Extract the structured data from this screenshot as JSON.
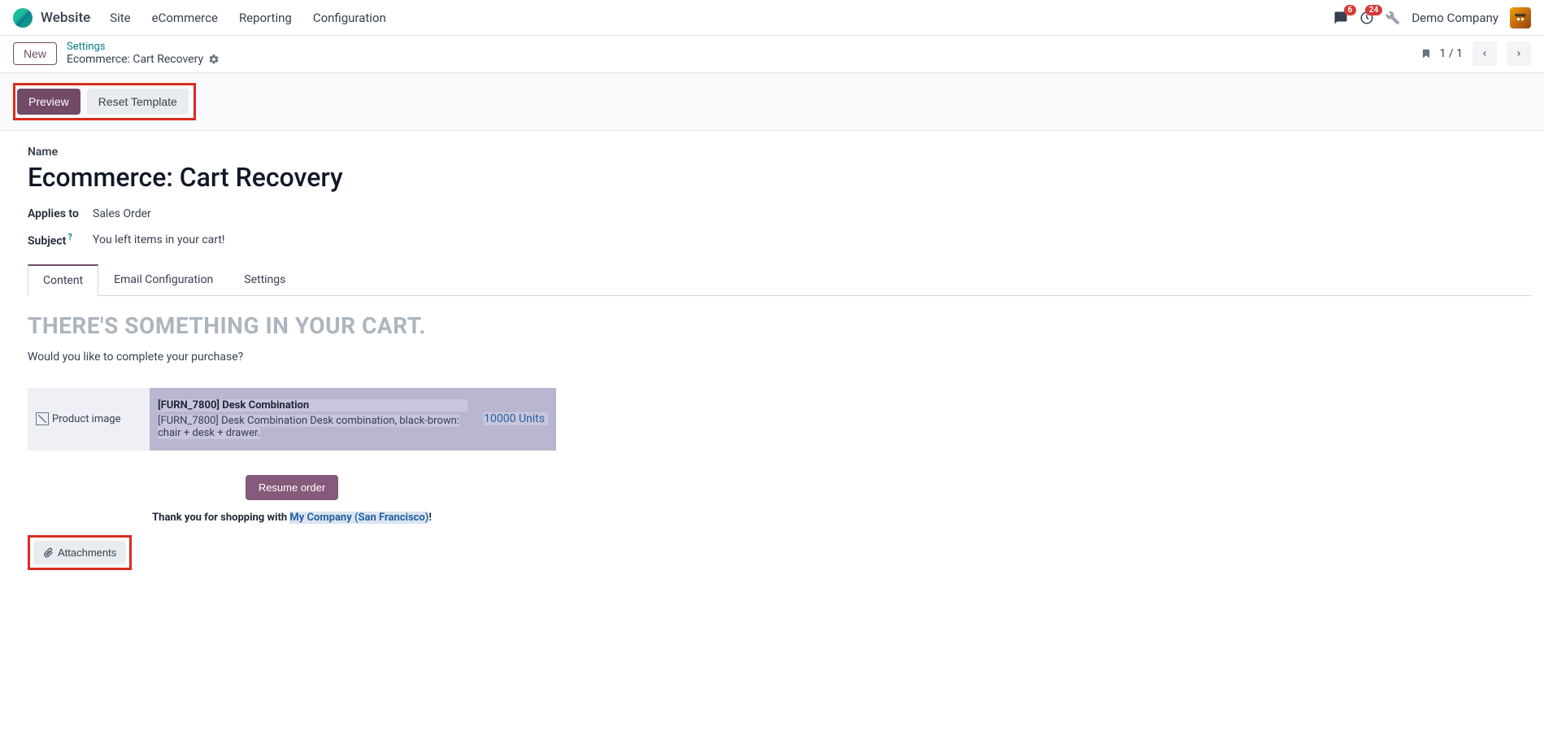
{
  "topnav": {
    "app_name": "Website",
    "items": [
      "Site",
      "eCommerce",
      "Reporting",
      "Configuration"
    ],
    "msg_badge": "6",
    "activity_badge": "24",
    "company": "Demo Company"
  },
  "breadcrumb": {
    "new_label": "New",
    "parent": "Settings",
    "current": "Ecommerce: Cart Recovery",
    "pager": "1 / 1"
  },
  "actions": {
    "preview": "Preview",
    "reset": "Reset Template"
  },
  "form": {
    "name_label": "Name",
    "name_value": "Ecommerce: Cart Recovery",
    "applies_label": "Applies to",
    "applies_value": "Sales Order",
    "subject_label": "Subject",
    "subject_help": "?",
    "subject_value": "You left items in your cart!"
  },
  "tabs": {
    "content": "Content",
    "email_config": "Email Configuration",
    "settings": "Settings"
  },
  "email": {
    "heading": "THERE'S SOMETHING IN YOUR CART.",
    "subtext": "Would you like to complete your purchase?",
    "img_alt": "Product image",
    "product_name": "[FURN_7800] Desk Combination",
    "product_desc": "[FURN_7800] Desk Combination Desk combination, black-brown: chair + desk + drawer.",
    "qty": "10000 Units",
    "resume": "Resume order",
    "thanks_pre": "Thank you for shopping with ",
    "thanks_company": "My Company (San Francisco)",
    "thanks_post": "!"
  },
  "attachments": {
    "label": "Attachments"
  }
}
